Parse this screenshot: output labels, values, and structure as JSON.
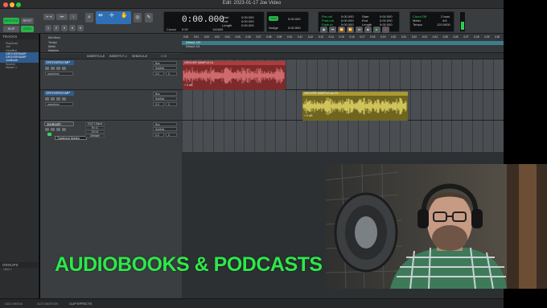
{
  "window": {
    "title": "Edit: 2023-01-17 Joe Video"
  },
  "toolbar": {
    "mode_shuffle": "SHUFFLE",
    "mode_spot": "SPOT",
    "mode_slip": "SLIP",
    "mode_grid": "GRID",
    "main_counter": "0:00.000",
    "cursor_label": "Cursor",
    "cursor_value": "0:00",
    "sample_info": "141600",
    "start_label": "Start",
    "end_label": "End",
    "length_label": "Length",
    "start_value": "0:00.000",
    "end_value": "0:00.000",
    "length_value": "0:00.000",
    "nudge_label": "Nudge",
    "nudge_value": "0:00.500",
    "grid_label": "Grid",
    "grid_value": "0:00.000",
    "preroll_label": "Pre-roll",
    "postroll_label": "Post-roll",
    "fadein_label": "Fade-in",
    "preroll_value": "0:00.000",
    "postroll_value": "0:00.000",
    "fadein_value": "0:00.000",
    "start2_value": "0:00.000",
    "end2_value": "0:00.000",
    "length2_value": "0:00.000",
    "countoff_label": "Count Off",
    "meter_label": "Meter",
    "tempo_label": "Tempo",
    "bars_value": "2 bars",
    "meter_value": "4/4",
    "tempo_value": "120.0000"
  },
  "tracks_panel": {
    "header": "TRACKS",
    "items": [
      "Playhead",
      "Joe",
      "Headline",
      "GROVERSAMP",
      "GROVERSAMP",
      "JoeBooth",
      "Submix",
      "Master 1"
    ]
  },
  "groups_panel": {
    "header": "GROUPS",
    "item": "<ALL>"
  },
  "columns": {
    "inserts_a_e": "INSERTS A-E",
    "inserts_f_j": "INSERTS F-J",
    "sends_a_e": "SENDS A-E",
    "io": "I / O"
  },
  "rulers": {
    "mins_secs": "Min:Secs",
    "tempo": "Tempo",
    "meter": "Meter",
    "markers": "Markers",
    "tempo_default": "Default: 120",
    "meter_default": "Default: 4/4",
    "ticks": [
      "0:00",
      "0:01",
      "0:02",
      "0:03",
      "0:04",
      "0:05",
      "0:06",
      "0:07",
      "0:08",
      "0:09",
      "0:10",
      "0:11",
      "0:12",
      "0:13",
      "0:14",
      "0:15",
      "0:16",
      "0:17",
      "0:18",
      "0:19",
      "0:20",
      "0:21",
      "0:22",
      "0:23",
      "0:24",
      "0:25",
      "0:26",
      "0:27",
      "0:28",
      "0:29",
      "0:30"
    ]
  },
  "tracks": [
    {
      "name": "GROVERSAMP",
      "view": "waveform",
      "input": "Bus",
      "output": "SubMix",
      "volume": "0.0",
      "pan": "0"
    },
    {
      "name": "GROVERSAMP",
      "view": "waveform",
      "input": "Bus",
      "output": "SubMix",
      "volume": "0.0",
      "pan": "0"
    },
    {
      "name": "JoeBooth",
      "view": "waveform",
      "input": "Bus",
      "output": "SubMix",
      "volume": "0.0",
      "pan": "0",
      "inserts": [
        "EQ3 7-Band",
        "Rx 11",
        "D3 LB",
        "Ultimate"
      ],
      "tooltip": "TrackInput Monitor"
    }
  ],
  "clips": [
    {
      "name": "GROVER SAMPLE-01",
      "gain": "+ 0 dB",
      "color": "#b03a3c"
    },
    {
      "name": "GROVER SAMPLE-sm-01",
      "gain": "+ 0 dB",
      "color": "#a99a34"
    }
  ],
  "bottom_tabs": [
    "ADD MEDIA",
    "AUTOMATION",
    "CLIP EFFECTS"
  ],
  "overlay": {
    "text": "AUDIOBOOKS & PODCASTS",
    "color": "#2de84a"
  },
  "colors": {
    "selected_blue": "#2f5c8f",
    "accent_green": "#29b34a"
  }
}
